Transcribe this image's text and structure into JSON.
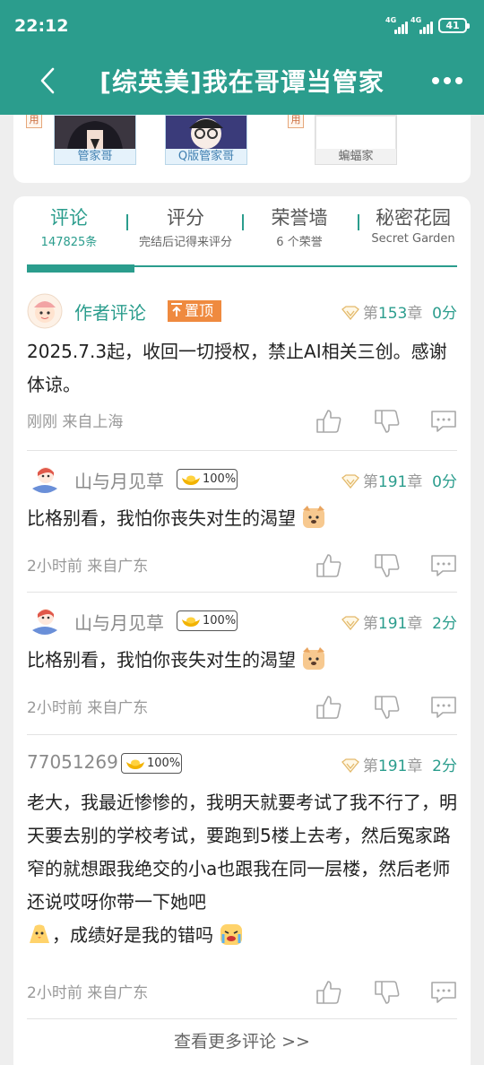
{
  "status_bar": {
    "time": "22:12",
    "network_1": "4G",
    "network_2": "4G",
    "battery": "41"
  },
  "header": {
    "title": "[综英美]我在哥谭当管家"
  },
  "character_cards": [
    {
      "name": "管家哥"
    },
    {
      "name": "Q版管家哥"
    },
    {
      "name": "蝙蝠家"
    }
  ],
  "role_tag": "用",
  "tabs": [
    {
      "label": "评论",
      "sub": "147825条"
    },
    {
      "label": "评分",
      "sub": "完结后记得来评分"
    },
    {
      "label": "荣誉墙",
      "sub": "6 个荣誉"
    },
    {
      "label": "秘密花园",
      "sub": "Secret Garden"
    }
  ],
  "comments": [
    {
      "name": "作者评论",
      "pin_label": "置顶",
      "chapter_prefix": "第",
      "chapter_num": "153",
      "chapter_suffix": "章",
      "score": "0分",
      "text": "2025.7.3起，收回一切授权，禁止AI相关三创。感谢体谅。",
      "meta": "刚刚   来自上海"
    },
    {
      "name": "山与月见草",
      "coin": "100%",
      "chapter_prefix": "第",
      "chapter_num": "191",
      "chapter_suffix": "章",
      "score": "0分",
      "text": "比格别看，我怕你丧失对生的渴望",
      "meta": "2小时前   来自广东"
    },
    {
      "name": "山与月见草",
      "coin": "100%",
      "chapter_prefix": "第",
      "chapter_num": "191",
      "chapter_suffix": "章",
      "score": "2分",
      "text": "比格别看，我怕你丧失对生的渴望",
      "meta": "2小时前   来自广东"
    },
    {
      "name": "77051269",
      "coin": "100%",
      "chapter_prefix": "第",
      "chapter_num": "191",
      "chapter_suffix": "章",
      "score": "2分",
      "text": "老大，我最近惨惨的，我明天就要考试了我不行了，明天要去别的学校考试，要跑到5楼上去考，然后冤家路窄的就想跟我绝交的小a也跟我在同一层楼，然后老师还说哎呀你带一下她吧",
      "text_2": "，成绩好是我的错吗",
      "meta": "2小时前   来自广东"
    }
  ],
  "more_comments": "查看更多评论 >>",
  "colors": {
    "accent": "#2b9d8d",
    "pin": "#ef8a3f",
    "text_gray": "#999999"
  },
  "icons": [
    "back-arrow-icon",
    "more-dots-icon",
    "like-icon",
    "dislike-icon",
    "reply-icon",
    "vip-diamond-icon",
    "gold-ingot-icon"
  ]
}
